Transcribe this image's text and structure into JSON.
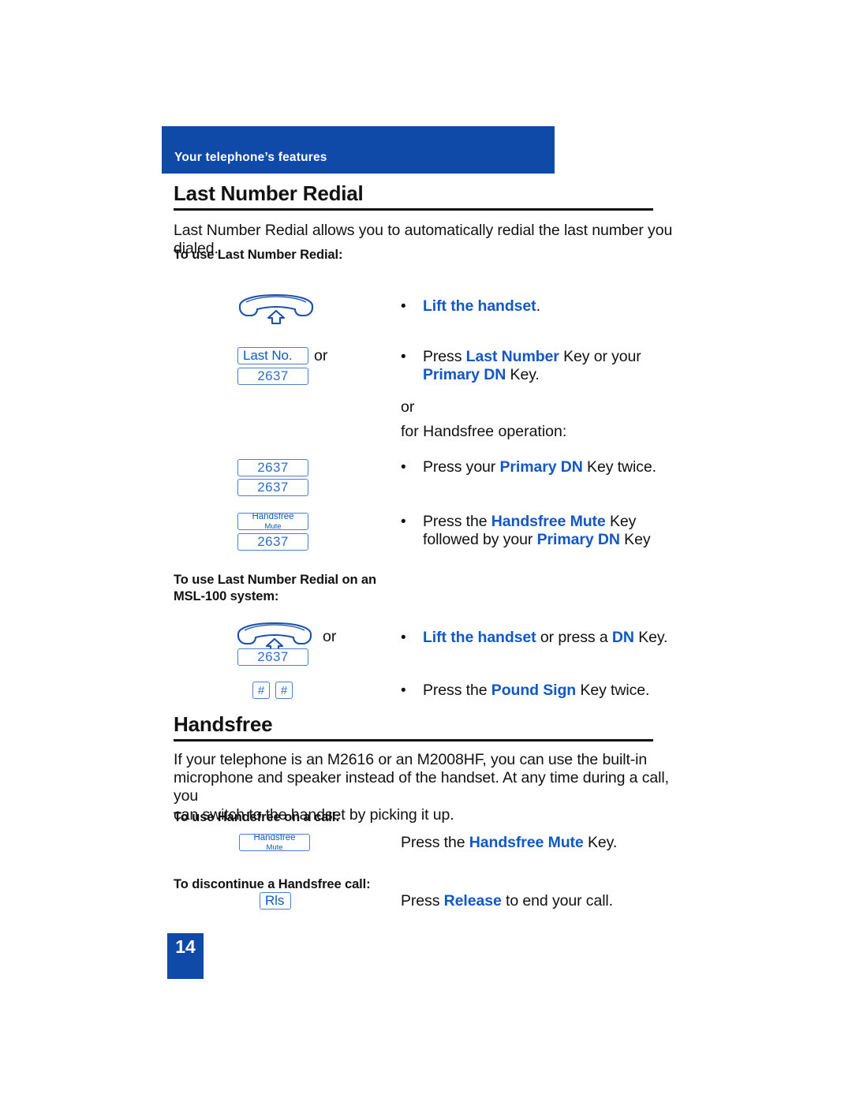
{
  "document": {
    "running_header": "Your telephone’s features",
    "page_number": "14",
    "accent_color": "#0f4aa8",
    "link_blue": "#1257c4",
    "key_border_color": "#4a7fd4"
  },
  "sections": [
    {
      "id": "last-number-redial",
      "title": "Last Number Redial",
      "intro": "Last Number Redial allows you to automatically redial the last number you dialed.",
      "lead_in_1": "To use Last Number Redial:",
      "lead_in_2_line1": "To use Last Number Redial on an",
      "lead_in_2_line2": "MSL-100 system:",
      "connector_or": "or",
      "handsfree_intro": "for Handsfree operation:",
      "steps": [
        {
          "id": "lift-handset",
          "bullet": "•",
          "text_blue": "Lift the handset",
          "text_tail": "."
        },
        {
          "id": "press-last-number",
          "bullet": "•",
          "line1_pre": "Press ",
          "line1_blue": "Last Number",
          "line1_post": " Key or your",
          "line2_blue": "Primary DN",
          "line2_post": " Key."
        },
        {
          "id": "press-primary-dn-twice",
          "bullet": "•",
          "line1_pre": "Press your ",
          "line1_blue": "Primary DN",
          "line1_post": " Key twice."
        },
        {
          "id": "press-handsfree-mute-then-dn",
          "bullet": "•",
          "line1_pre": "Press the ",
          "line1_blue": "Handsfree Mute",
          "line1_post": " Key",
          "line2_pre": "followed by your ",
          "line2_blue": "Primary DN",
          "line2_post": " Key"
        },
        {
          "id": "lift-handset-or-dn",
          "bullet": "•",
          "line1_blue": "Lift the handset",
          "line1_mid": " or press a ",
          "line1_blue2": "DN",
          "line1_post": " Key."
        },
        {
          "id": "press-pound-twice",
          "bullet": "•",
          "line1_pre": "Press the ",
          "line1_blue": "Pound Sign",
          "line1_post": " Key twice."
        }
      ]
    },
    {
      "id": "handsfree",
      "title": "Handsfree",
      "intro_line1": "If your telephone is an M2616 or an M2008HF, you can use the built-in",
      "intro_line2": "microphone and speaker instead of the handset. At any time during a call, you",
      "intro_line3": "can switch to the handset by picking it up.",
      "lead_in_1": "To use Handsfree on a call:",
      "lead_in_2": "To discontinue a Handsfree call:",
      "steps": [
        {
          "id": "press-handsfree-mute",
          "pre": "Press the ",
          "blue": "Handsfree Mute",
          "post": " Key."
        },
        {
          "id": "press-release",
          "pre": "Press ",
          "blue": "Release",
          "post": " to end your call."
        }
      ]
    }
  ],
  "keys": {
    "last_no": "Last No.",
    "dn_2637": "2637",
    "handsfree_line1": "Handsfree",
    "handsfree_line2": "Mute",
    "pound": "#",
    "release": "Rls"
  },
  "icons": {
    "handset": "handset-lift-icon"
  }
}
